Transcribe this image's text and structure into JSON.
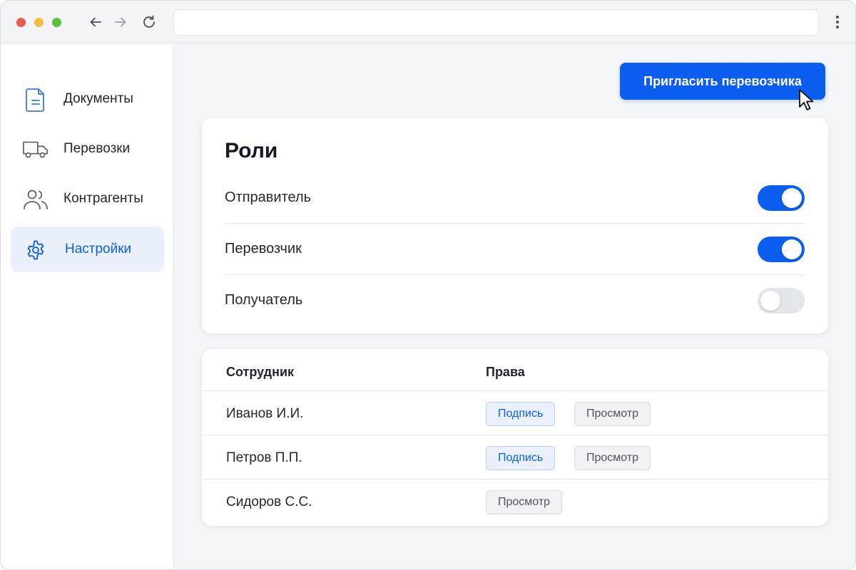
{
  "browser": {
    "url": "",
    "colors": {
      "close": "#ee5a52",
      "minimize": "#f3bd3f",
      "maximize": "#59c23e"
    }
  },
  "sidebar": {
    "items": [
      {
        "label": "Документы",
        "icon": "document-icon",
        "active": false
      },
      {
        "label": "Перевозки",
        "icon": "truck-icon",
        "active": false
      },
      {
        "label": "Контрагенты",
        "icon": "users-icon",
        "active": false
      },
      {
        "label": "Настройки",
        "icon": "gear-icon",
        "active": true
      }
    ]
  },
  "header": {
    "invite_label": "Пригласить перевозчика"
  },
  "roles": {
    "title": "Роли",
    "items": [
      {
        "label": "Отправитель",
        "enabled": true
      },
      {
        "label": "Перевозчик",
        "enabled": true
      },
      {
        "label": "Получатель",
        "enabled": false
      }
    ]
  },
  "staff": {
    "columns": [
      "Сотрудник",
      "Права"
    ],
    "rows": [
      {
        "name": "Иванов И.И.",
        "permissions": [
          "Подпись",
          "Просмотр"
        ]
      },
      {
        "name": "Петров П.П.",
        "permissions": [
          "Подпись",
          "Просмотр"
        ]
      },
      {
        "name": "Сидоров С.С.",
        "permissions": [
          "Просмотр"
        ]
      }
    ]
  },
  "theme": {
    "accent": "#0b5ef0",
    "active_nav_bg": "#eaf1fd",
    "active_nav_text": "#0c5fdb"
  }
}
